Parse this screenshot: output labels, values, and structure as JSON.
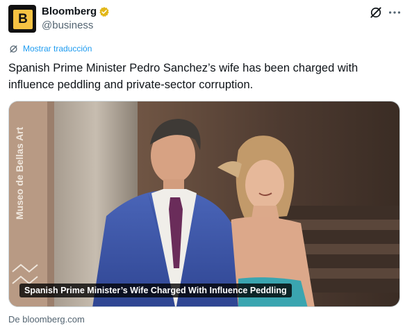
{
  "author": {
    "name": "Bloomberg",
    "handle": "@business",
    "logo_letter": "B",
    "logo_bg": "#111111",
    "logo_accent": "#f6c343",
    "verified_color": "#e2b719"
  },
  "translate": {
    "label": "Mostrar traducción"
  },
  "tweet": {
    "text": "Spanish Prime Minister Pedro Sanchez’s wife has been charged with influence peddling and private-sector corruption."
  },
  "media": {
    "caption": "Spanish Prime Minister’s Wife Charged With Influence Peddling",
    "sign_text": "Museo de Bellas Art"
  },
  "card": {
    "source": "De bloomberg.com"
  },
  "colors": {
    "link": "#1d9bf0",
    "secondary": "#536471",
    "text": "#0f1419"
  }
}
